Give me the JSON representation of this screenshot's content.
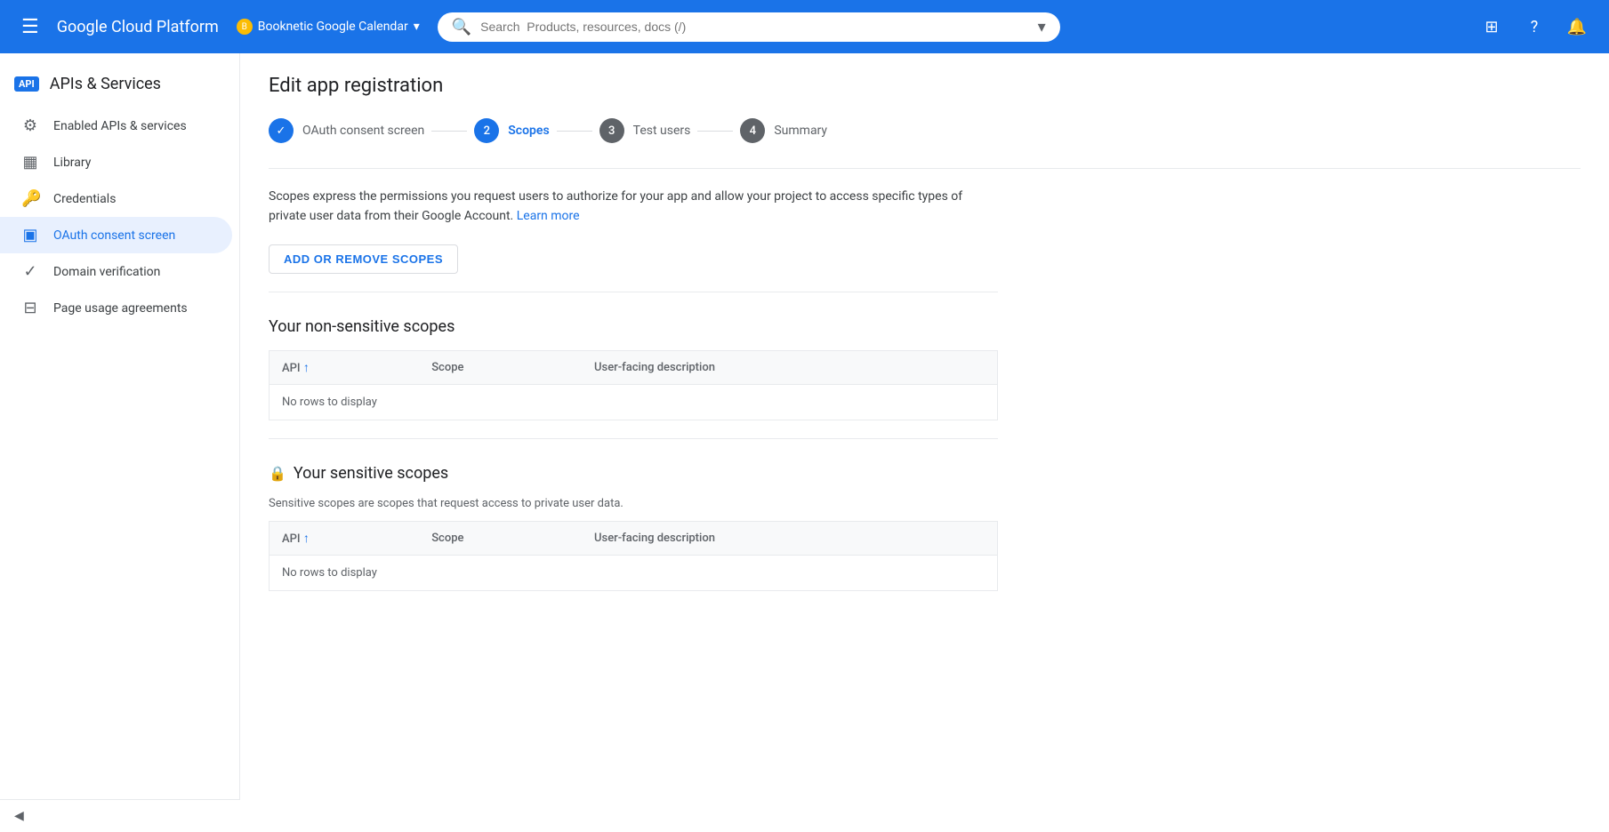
{
  "topnav": {
    "brand": "Google Cloud Platform",
    "project_name": "Booknetic Google Calendar",
    "project_dot_label": "B",
    "search_placeholder": "Search  Products, resources, docs (/)",
    "hamburger_icon": "☰",
    "chevron_down_icon": "▾",
    "icons": {
      "apps": "⊞",
      "support": "?",
      "notifications": "🔔"
    }
  },
  "sidebar": {
    "header": "APIs & Services",
    "api_badge": "API",
    "items": [
      {
        "id": "enabled-apis",
        "label": "Enabled APIs & services",
        "icon": "⚙"
      },
      {
        "id": "library",
        "label": "Library",
        "icon": "▦"
      },
      {
        "id": "credentials",
        "label": "Credentials",
        "icon": "🔑"
      },
      {
        "id": "oauth-consent",
        "label": "OAuth consent screen",
        "icon": "▣",
        "active": true
      },
      {
        "id": "domain-verification",
        "label": "Domain verification",
        "icon": "✓"
      },
      {
        "id": "page-usage",
        "label": "Page usage agreements",
        "icon": "⊟"
      }
    ],
    "collapse_icon": "◀"
  },
  "page": {
    "title": "Edit app registration"
  },
  "stepper": {
    "steps": [
      {
        "id": "oauth-consent",
        "number": "✓",
        "label": "OAuth consent screen",
        "state": "done"
      },
      {
        "id": "scopes",
        "number": "2",
        "label": "Scopes",
        "state": "active"
      },
      {
        "id": "test-users",
        "number": "3",
        "label": "Test users",
        "state": "inactive"
      },
      {
        "id": "summary",
        "number": "4",
        "label": "Summary",
        "state": "inactive"
      }
    ]
  },
  "scopes_section": {
    "description": "Scopes express the permissions you request users to authorize for your app and allow your project to access specific types of private user data from their Google Account.",
    "learn_more_text": "Learn more",
    "add_remove_button": "ADD OR REMOVE SCOPES",
    "non_sensitive": {
      "title": "Your non-sensitive scopes",
      "table": {
        "columns": [
          "API",
          "Scope",
          "User-facing description"
        ],
        "sort_col": "API",
        "empty_message": "No rows to display"
      }
    },
    "sensitive": {
      "title": "Your sensitive scopes",
      "description": "Sensitive scopes are scopes that request access to private user data.",
      "table": {
        "columns": [
          "API",
          "Scope",
          "User-facing description"
        ],
        "sort_col": "API",
        "empty_message": "No rows to display"
      }
    }
  }
}
